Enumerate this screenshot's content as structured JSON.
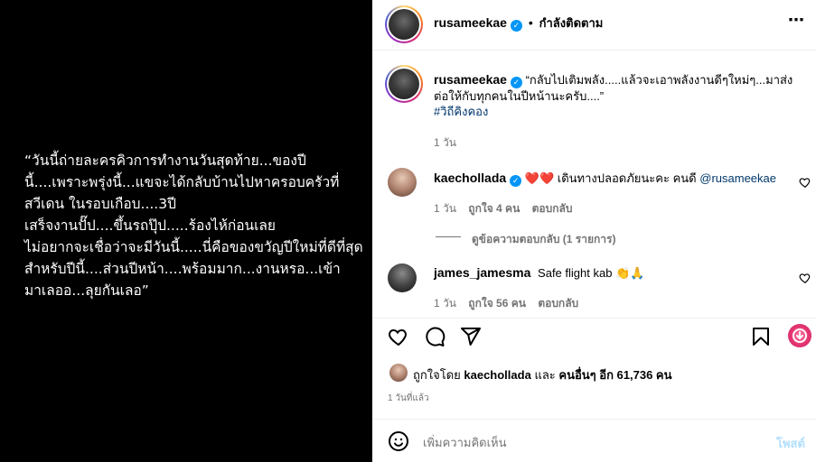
{
  "post_image": {
    "text": "“วันนี้ถ่ายละครคิวการทำงานวันสุดท้าย...ของปีนี้....เพราะพรุ่งนี้...แขจะได้กลับบ้านไปหาครอบครัวที่สวีเดน ในรอบเกือบ....3ปี\nเสร็จงานปั๊ป....ขึ้นรถปุ๊ป.....ร้องไห้ก่อนเลย\nไม่อยากจะเชื่อว่าจะมีวันนี้.....นี่คือของขวัญปีใหม่ที่ดีที่สุดสำหรับปีนี้....ส่วนปีหน้า....พร้อมมาก...งานหรอ...เข้ามาเลออ...ลุยกันเลอ”"
  },
  "header": {
    "username": "rusameekae",
    "separator": "•",
    "follow_status": "กำลังติดตาม",
    "more": "⋯"
  },
  "caption": {
    "username": "rusameekae",
    "text": "“กลับไปเติมพลัง.....แล้วจะเอาพลังงานดีๆใหม่ๆ...มาส่งต่อให้กับทุกคนในปีหน้านะครับ....”",
    "hashtag": "#วิถีคิงคอง",
    "time": "1 วัน"
  },
  "comments": [
    {
      "username": "kaechollada",
      "emoji": "❤️❤️",
      "text": "เดินทางปลอดภัยนะคะ คนดี",
      "mention": "@rusameekae",
      "time": "1 วัน",
      "likes": "ถูกใจ 4 คน",
      "reply": "ตอบกลับ",
      "view_replies": "ดูข้อความตอบกลับ (1 รายการ)"
    },
    {
      "username": "james_jamesma",
      "text": "Safe flight kab",
      "emoji": "👏🙏",
      "time": "1 วัน",
      "likes": "ถูกใจ 56 คน",
      "reply": "ตอบกลับ"
    }
  ],
  "likes_bar": {
    "prefix": "ถูกใจโดย",
    "user": "kaechollada",
    "mid": "และ",
    "others": "คนอื่นๆ อีก 61,736 คน"
  },
  "post_time": "1 วันที่แล้ว",
  "comment_box": {
    "placeholder": "เพิ่มความคิดเห็น",
    "post_label": "โพสต์"
  },
  "colors": {
    "accent": "#0095f6",
    "heart": "#ff3040",
    "muted": "#737373"
  }
}
